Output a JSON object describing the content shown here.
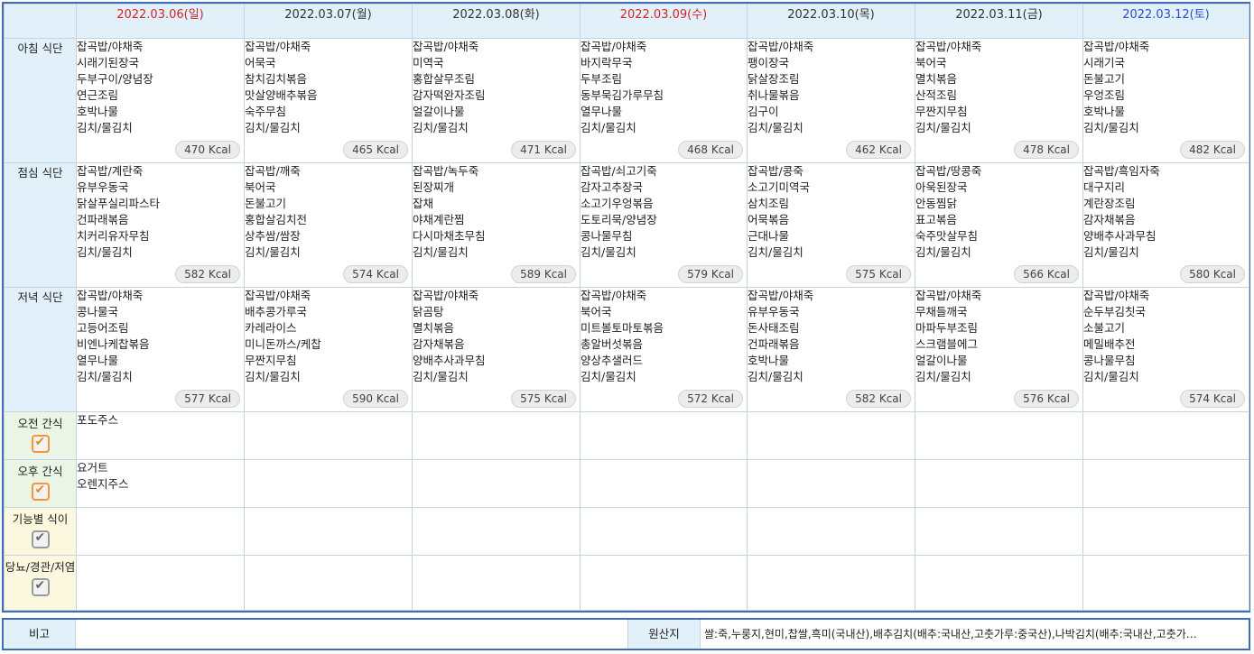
{
  "days": [
    {
      "label": "2022.03.06(일)",
      "type": "sun"
    },
    {
      "label": "2022.03.07(월)",
      "type": "normal"
    },
    {
      "label": "2022.03.08(화)",
      "type": "normal"
    },
    {
      "label": "2022.03.09(수)",
      "type": "holiday"
    },
    {
      "label": "2022.03.10(목)",
      "type": "normal"
    },
    {
      "label": "2022.03.11(금)",
      "type": "normal"
    },
    {
      "label": "2022.03.12(토)",
      "type": "sat"
    }
  ],
  "meals": [
    {
      "label": "아침 식단",
      "cells": [
        {
          "items": [
            "잡곡밥/야채죽",
            "시래기된장국",
            "두부구이/양념장",
            "연근조림",
            "호박나물",
            "김치/물김치"
          ],
          "kcal": "470 Kcal"
        },
        {
          "items": [
            "잡곡밥/야채죽",
            "어묵국",
            "참치김치볶음",
            "맛살양배추볶음",
            "숙주무침",
            "김치/물김치"
          ],
          "kcal": "465 Kcal"
        },
        {
          "items": [
            "잡곡밥/야채죽",
            "미역국",
            "홍합살무조림",
            "감자떡완자조림",
            "얼갈이나물",
            "김치/물김치"
          ],
          "kcal": "471 Kcal"
        },
        {
          "items": [
            "잡곡밥/야채죽",
            "바지락무국",
            "두부조림",
            "동부묵김가루무침",
            "열무나물",
            "김치/물김치"
          ],
          "kcal": "468 Kcal"
        },
        {
          "items": [
            "잡곡밥/야채죽",
            "팽이장국",
            "닭살장조림",
            "취나물볶음",
            "김구이",
            "김치/물김치"
          ],
          "kcal": "462 Kcal"
        },
        {
          "items": [
            "잡곡밥/야채죽",
            "북어국",
            "멸치볶음",
            "산적조림",
            "무짠지무침",
            "김치/물김치"
          ],
          "kcal": "478 Kcal"
        },
        {
          "items": [
            "잡곡밥/야채죽",
            "시래기국",
            "돈불고기",
            "우엉조림",
            "호박나물",
            "김치/물김치"
          ],
          "kcal": "482 Kcal"
        }
      ]
    },
    {
      "label": "점심 식단",
      "cells": [
        {
          "items": [
            "잡곡밥/계란죽",
            "유부우동국",
            "닭살푸실리파스타",
            "건파래볶음",
            "치커리유자무침",
            "김치/물김치"
          ],
          "kcal": "582 Kcal"
        },
        {
          "items": [
            "잡곡밥/깨죽",
            "북어국",
            "돈불고기",
            "홍합살김치전",
            "상추쌈/쌈장",
            "김치/물김치"
          ],
          "kcal": "574 Kcal"
        },
        {
          "items": [
            "잡곡밥/녹두죽",
            "된장찌개",
            "잡채",
            "야채계란찜",
            "다시마채초무침",
            "김치/물김치"
          ],
          "kcal": "589 Kcal"
        },
        {
          "items": [
            "잡곡밥/쇠고기죽",
            "감자고추장국",
            "소고기우엉볶음",
            "도토리묵/양념장",
            "콩나물무침",
            "김치/물김치"
          ],
          "kcal": "579 Kcal"
        },
        {
          "items": [
            "잡곡밥/콩죽",
            "소고기미역국",
            "삼치조림",
            "어묵볶음",
            "근대나물",
            "김치/물김치"
          ],
          "kcal": "575 Kcal"
        },
        {
          "items": [
            "잡곡밥/땅콩죽",
            "아욱된장국",
            "안동찜닭",
            "표고볶음",
            "숙주맛살무침",
            "김치/물김치"
          ],
          "kcal": "566 Kcal"
        },
        {
          "items": [
            "잡곡밥/흑임자죽",
            "대구지리",
            "계란장조림",
            "감자채볶음",
            "양배추사과무침",
            "김치/물김치"
          ],
          "kcal": "580 Kcal"
        }
      ]
    },
    {
      "label": "저녁 식단",
      "cells": [
        {
          "items": [
            "잡곡밥/야채죽",
            "콩나물국",
            "고등어조림",
            "비엔나케찹볶음",
            "열무나물",
            "김치/물김치"
          ],
          "kcal": "577 Kcal"
        },
        {
          "items": [
            "잡곡밥/야채죽",
            "배추콩가루국",
            "카레라이스",
            "미니돈까스/케찹",
            "무짠지무침",
            "김치/물김치"
          ],
          "kcal": "590 Kcal"
        },
        {
          "items": [
            "잡곡밥/야채죽",
            "닭곰탕",
            "멸치볶음",
            "감자채볶음",
            "양배추사과무침",
            "김치/물김치"
          ],
          "kcal": "575 Kcal"
        },
        {
          "items": [
            "잡곡밥/야채죽",
            "북어국",
            "미트볼토마토볶음",
            "총알버섯볶음",
            "양상추샐러드",
            "김치/물김치"
          ],
          "kcal": "572 Kcal"
        },
        {
          "items": [
            "잡곡밥/야채죽",
            "유부우동국",
            "돈사태조림",
            "건파래볶음",
            "호박나물",
            "김치/물김치"
          ],
          "kcal": "582 Kcal"
        },
        {
          "items": [
            "잡곡밥/야채죽",
            "무채들깨국",
            "마파두부조림",
            "스크램블에그",
            "얼갈이나물",
            "김치/물김치"
          ],
          "kcal": "576 Kcal"
        },
        {
          "items": [
            "잡곡밥/야채죽",
            "순두부김칫국",
            "소불고기",
            "메밀배추전",
            "콩나물무침",
            "김치/물김치"
          ],
          "kcal": "574 Kcal"
        }
      ]
    }
  ],
  "extras": [
    {
      "label": "오전 간식",
      "checked": true,
      "kind": "snack",
      "cells": [
        [
          "포도주스"
        ],
        [],
        [],
        [],
        [],
        [],
        []
      ]
    },
    {
      "label": "오후 간식",
      "checked": true,
      "kind": "snack",
      "cells": [
        [
          "요거트",
          "오렌지주스"
        ],
        [],
        [],
        [],
        [],
        [],
        []
      ]
    },
    {
      "label": "기능별 식이",
      "checked": false,
      "kind": "diet",
      "cells": [
        [],
        [],
        [],
        [],
        [],
        [],
        []
      ]
    },
    {
      "label": "당뇨/경관/저염",
      "checked": false,
      "kind": "diet",
      "cells": [
        [],
        [],
        [],
        [],
        [],
        [],
        []
      ]
    }
  ],
  "footer": {
    "note_label": "비고",
    "note_value": "",
    "origin_label": "원산지",
    "origin_value": "쌀:죽,누룽지,현미,찹쌀,흑미(국내산),배추김치(배추:국내산,고춧가루:중국산),나박김치(배추:국내산,고춧가…"
  },
  "colors": {
    "header_bg": "#e2f0f9",
    "border": "#3a6fb5",
    "sunday": "#d2242f",
    "saturday": "#2a4fc7",
    "check_on": "#f29637"
  }
}
